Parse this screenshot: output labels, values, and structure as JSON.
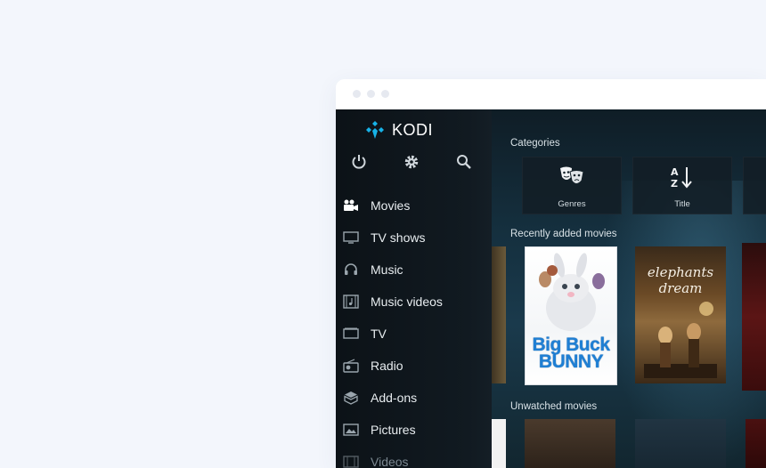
{
  "app": {
    "name": "KODI"
  },
  "top_icons": [
    "power-icon",
    "gear-icon",
    "search-icon"
  ],
  "sidebar": {
    "items": [
      {
        "label": "Movies",
        "icon": "movie-camera-icon"
      },
      {
        "label": "TV shows",
        "icon": "tv-icon"
      },
      {
        "label": "Music",
        "icon": "headphones-icon"
      },
      {
        "label": "Music videos",
        "icon": "music-video-icon"
      },
      {
        "label": "TV",
        "icon": "tv-icon"
      },
      {
        "label": "Radio",
        "icon": "radio-icon"
      },
      {
        "label": "Add-ons",
        "icon": "box-icon"
      },
      {
        "label": "Pictures",
        "icon": "picture-icon"
      },
      {
        "label": "Videos",
        "icon": "film-icon"
      }
    ]
  },
  "content": {
    "categories_title": "Categories",
    "categories": [
      {
        "label": "Genres",
        "icon": "theater-masks-icon"
      },
      {
        "label": "Title",
        "icon": "sort-az-icon"
      }
    ],
    "recently_added_title": "Recently added movies",
    "recently_added": [
      {
        "title": "Big Buck BUNNY"
      },
      {
        "title": "elephants dream"
      }
    ],
    "unwatched_title": "Unwatched movies"
  },
  "colors": {
    "accent": "#17b2e7",
    "background": "#f3f6fc",
    "sidebar": "#0e161c"
  }
}
